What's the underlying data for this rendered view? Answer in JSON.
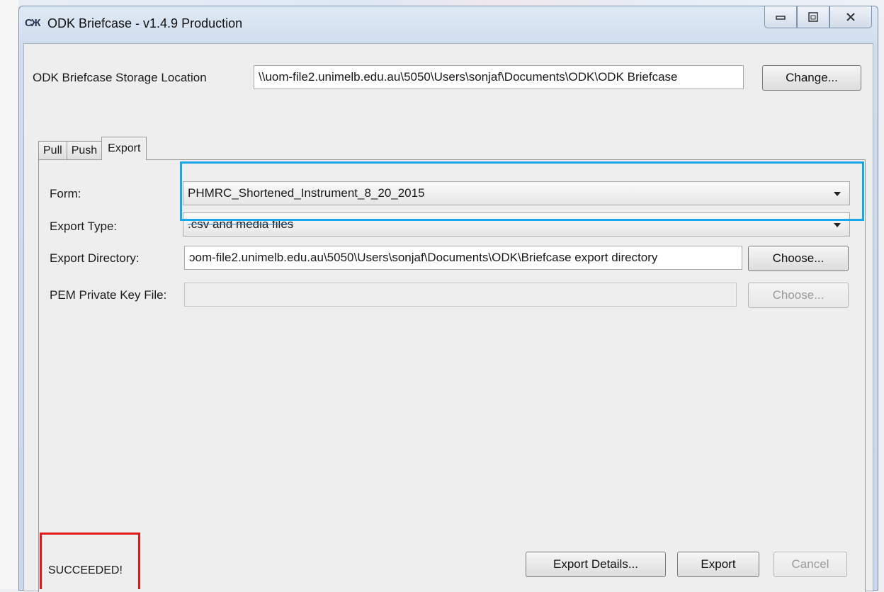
{
  "window": {
    "title": "ODK Briefcase - v1.4.9 Production",
    "icon_text": "СЖ",
    "controls": {
      "minimize_icon": "minimize-icon",
      "maximize_icon": "maximize-icon",
      "close_icon": "close-icon"
    }
  },
  "storage": {
    "label": "ODK Briefcase Storage Location",
    "value": "\\\\uom-file2.unimelb.edu.au\\5050\\Users\\sonjaf\\Documents\\ODK\\ODK Briefcase",
    "change_button": "Change..."
  },
  "tabs": [
    {
      "label": "Pull",
      "active": false
    },
    {
      "label": "Push",
      "active": false
    },
    {
      "label": "Export",
      "active": true
    }
  ],
  "export_form": {
    "form_label": "Form:",
    "form_value": "PHMRC_Shortened_Instrument_8_20_2015",
    "export_type_label": "Export Type:",
    "export_type_value": ".csv and media files",
    "export_dir_label": "Export Directory:",
    "export_dir_value": "ɔom-file2.unimelb.edu.au\\5050\\Users\\sonjaf\\Documents\\ODK\\Briefcase export directory",
    "choose_button": "Choose...",
    "pem_label": "PEM Private Key File:",
    "pem_value": "",
    "pem_choose_button": "Choose..."
  },
  "status": {
    "text": "SUCCEEDED!"
  },
  "actions": {
    "export_details_button": "Export Details...",
    "export_button": "Export",
    "cancel_button": "Cancel"
  },
  "annotations": {
    "blue_highlight_color": "#1aa7e8",
    "red_highlight_color": "#e21818"
  }
}
